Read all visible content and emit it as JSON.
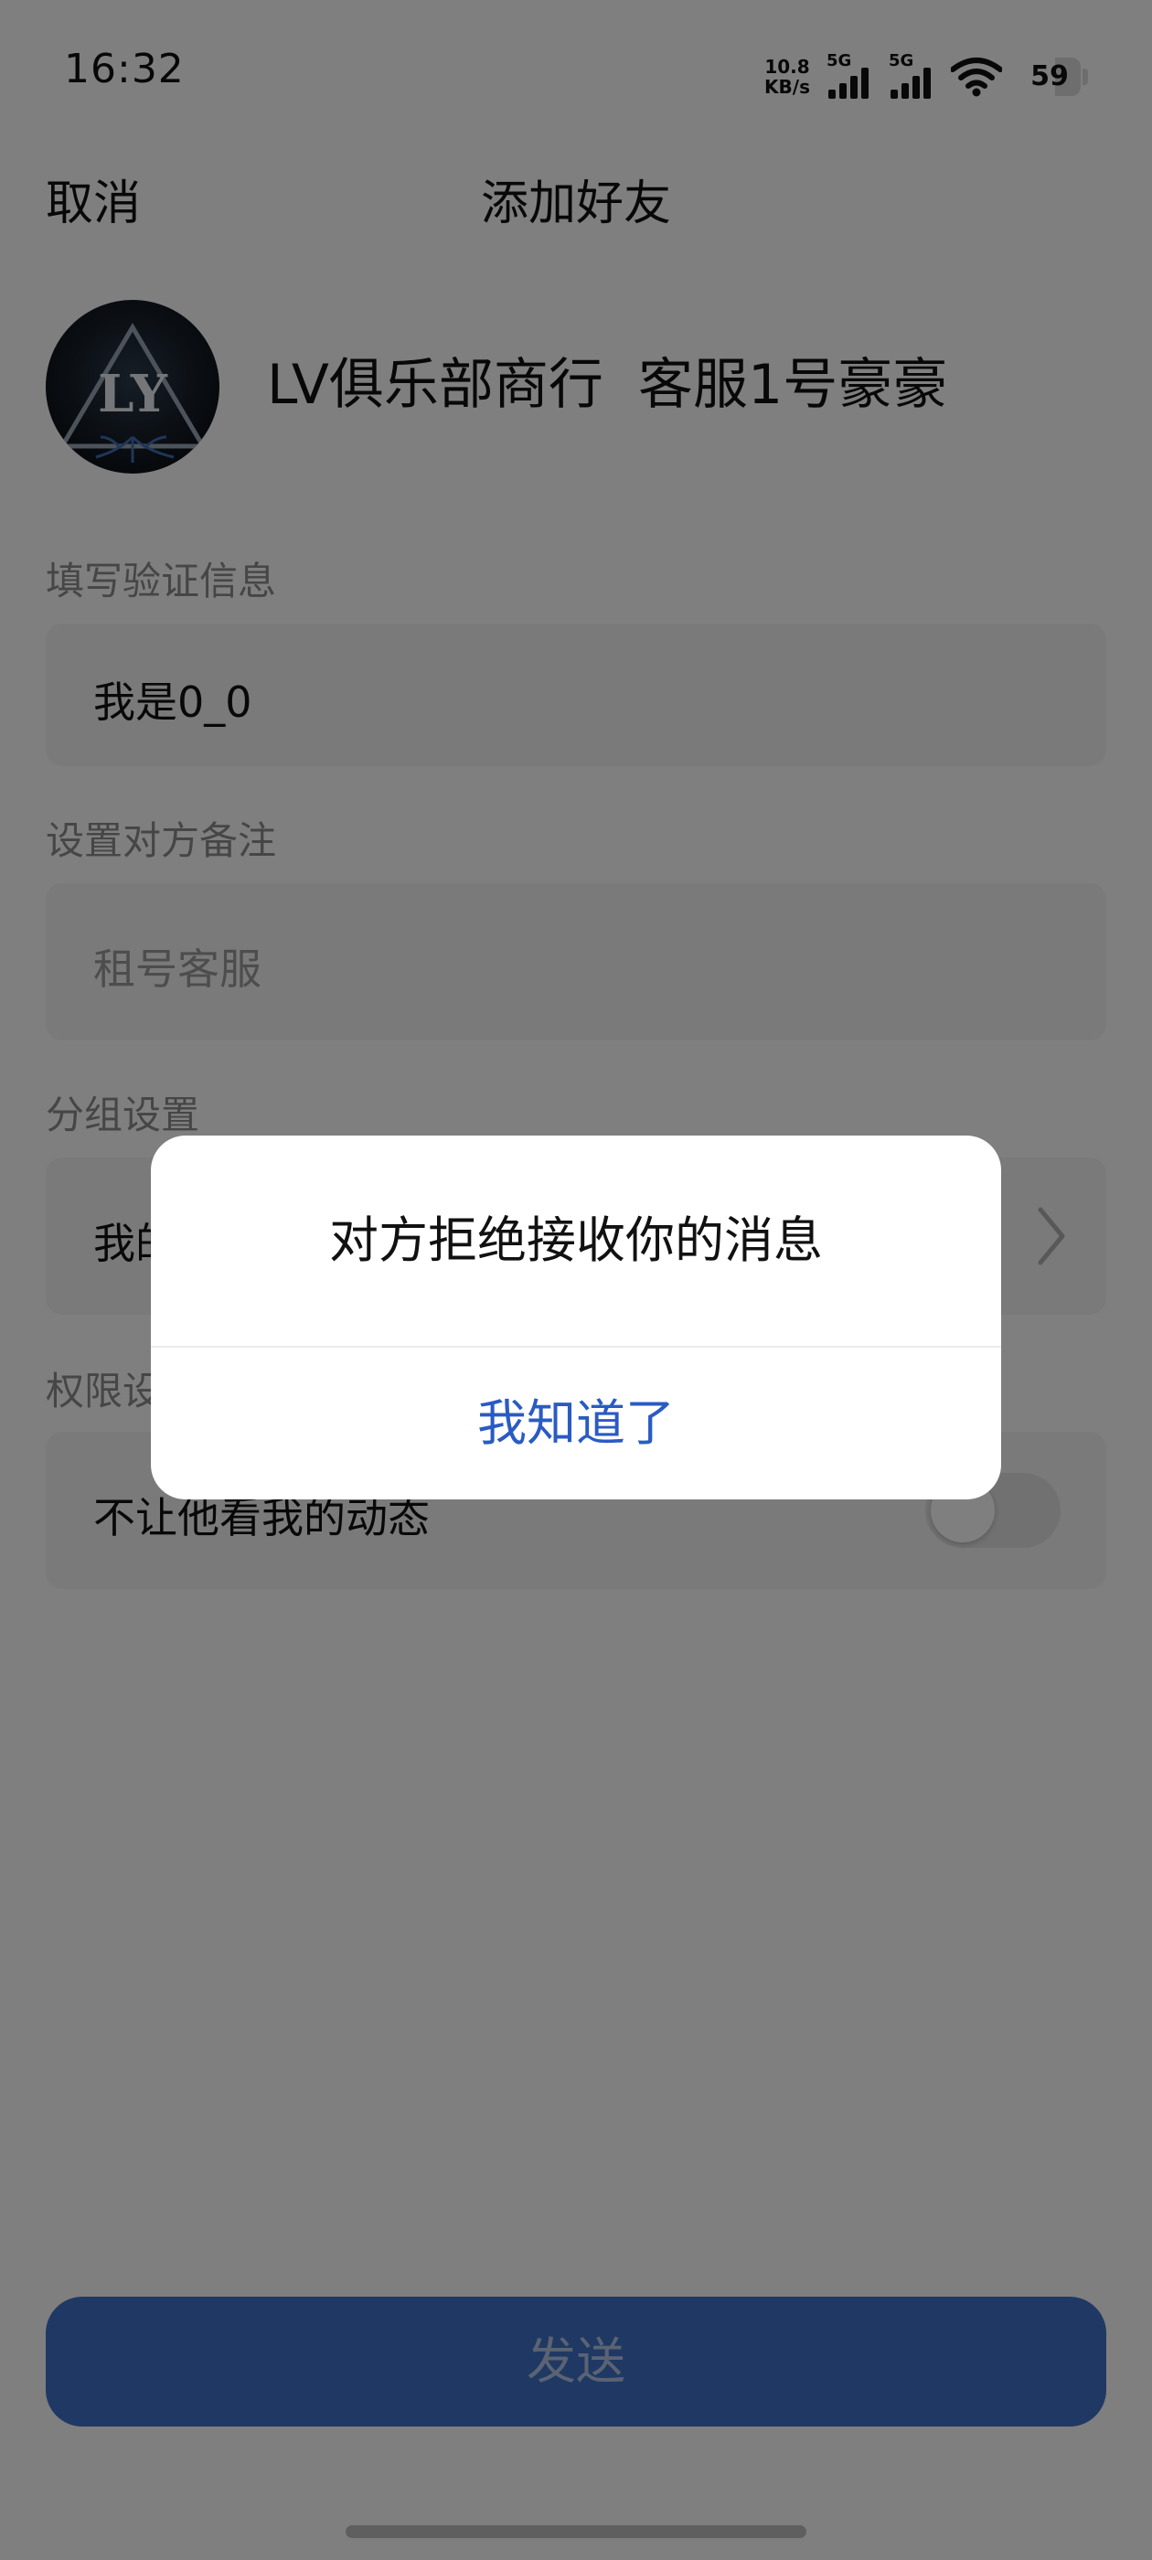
{
  "status_bar": {
    "time": "16:32",
    "net_speed_value": "10.8",
    "net_speed_unit": "KB/s",
    "sim1_label": "5G",
    "sim2_label": "5G",
    "battery_level": "59"
  },
  "nav": {
    "cancel_label": "取消",
    "title": "添加好友"
  },
  "profile": {
    "avatar_text": "LY",
    "name": "LV俱乐部商行  客服1号豪豪"
  },
  "form": {
    "verify_label": "填写验证信息",
    "verify_value": "我是0_0",
    "remark_label": "设置对方备注",
    "remark_placeholder": "租号客服",
    "group_label": "分组设置",
    "group_value_visible": "我的",
    "permission_label_visible": "权限设",
    "permission_item": "不让他看我的动态",
    "permission_toggle_on": false
  },
  "send_label": "发送",
  "dialog": {
    "message": "对方拒绝接收你的消息",
    "confirm_label": "我知道了"
  },
  "colors": {
    "accent": "#3f73c9",
    "dialog_button": "#2a5bc4",
    "overlay": "rgba(0,0,0,0.5)"
  }
}
